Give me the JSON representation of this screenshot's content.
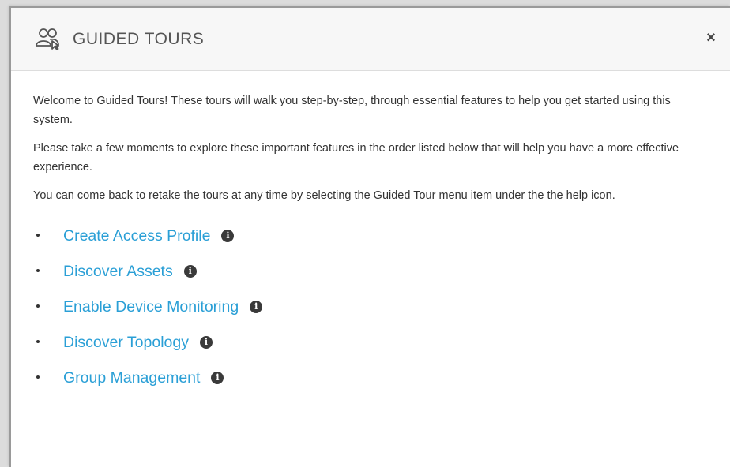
{
  "dialog": {
    "title": "GUIDED TOURS",
    "title_icon": "users-icon",
    "close_label": "×",
    "paragraphs": [
      "Welcome to Guided Tours! These tours will walk you step-by-step, through essential features to help you get started using this system.",
      "Please take a few moments to explore these important features in the order listed below that will help you have a more effective experience.",
      "You can come back to retake the tours at any time by selecting the Guided Tour menu item under the the help icon."
    ],
    "tours": [
      {
        "label": "Create Access Profile",
        "info_icon": "info-icon"
      },
      {
        "label": "Discover Assets",
        "info_icon": "info-icon"
      },
      {
        "label": "Enable Device Monitoring",
        "info_icon": "info-icon"
      },
      {
        "label": "Discover Topology",
        "info_icon": "info-icon"
      },
      {
        "label": "Group Management",
        "info_icon": "info-icon"
      }
    ],
    "info_glyph": "i"
  },
  "colors": {
    "link": "#2a9fd6",
    "header_bg": "#f7f7f7",
    "text": "#333333"
  }
}
